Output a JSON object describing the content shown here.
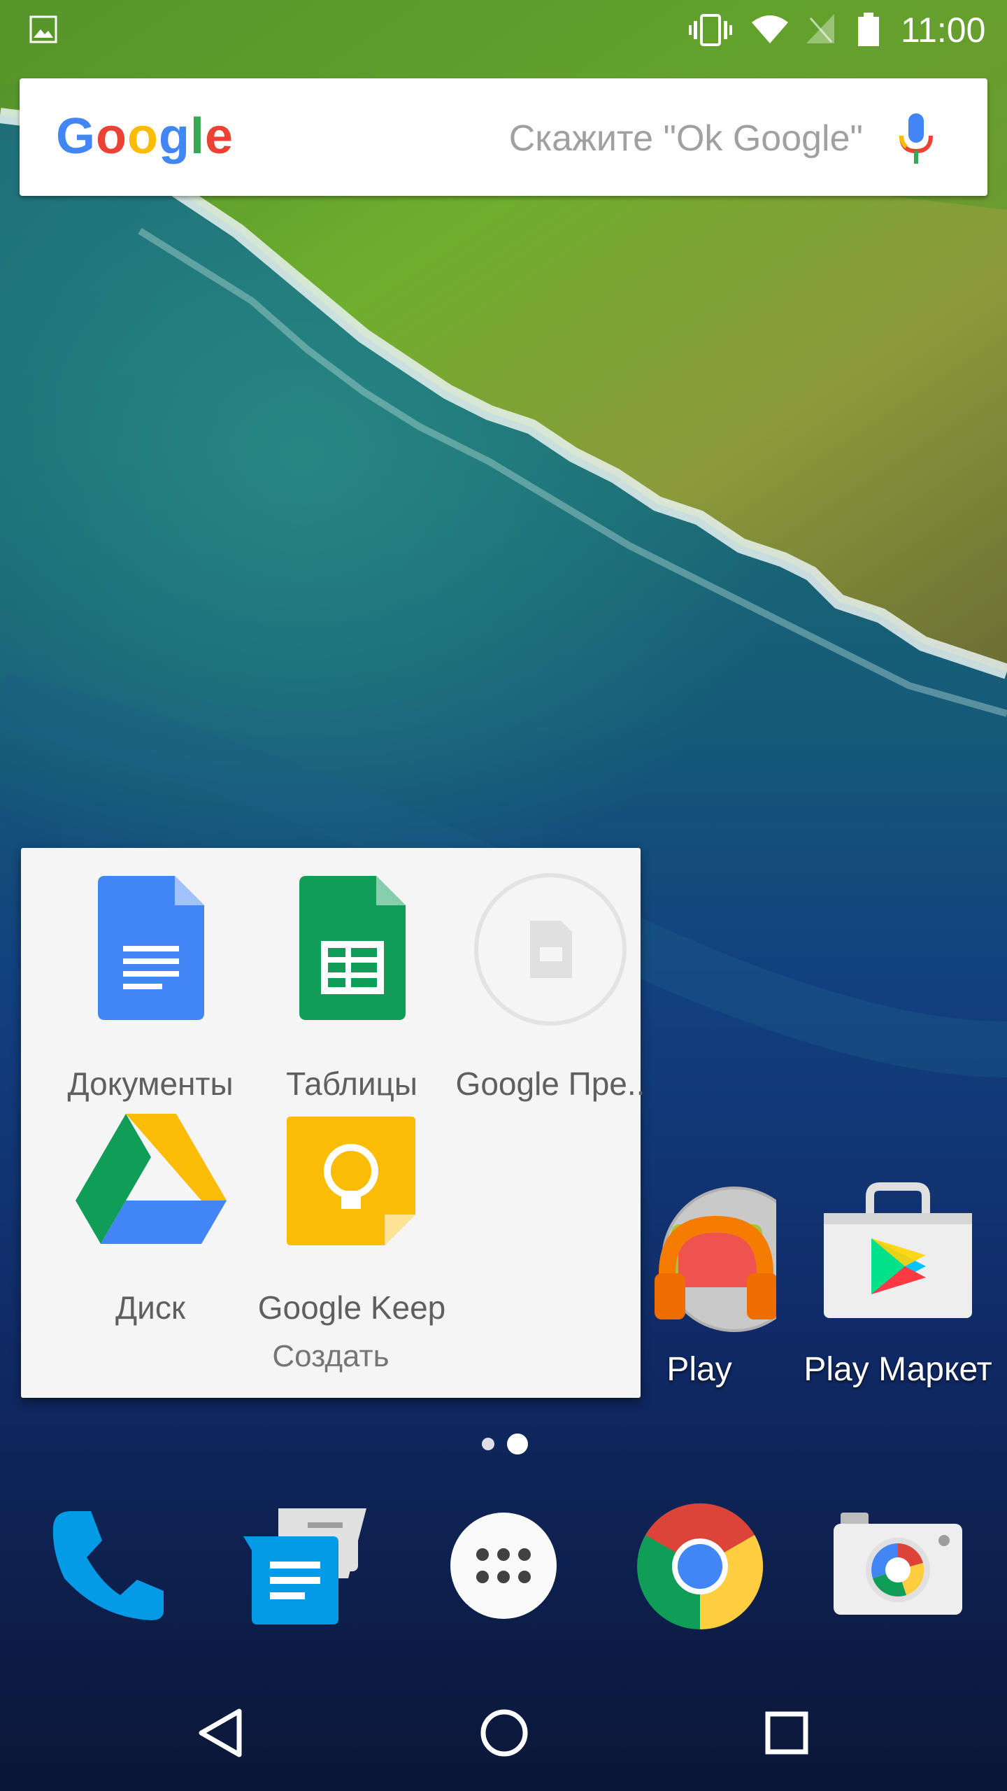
{
  "status_bar": {
    "time": "11:00",
    "icons": [
      "image-icon",
      "vibrate-icon",
      "wifi-icon",
      "no-signal-icon",
      "battery-icon"
    ]
  },
  "search": {
    "logo": [
      "G",
      "o",
      "o",
      "g",
      "l",
      "e"
    ],
    "hint": "Скажите \"Ok Google\"",
    "icon": "mic-icon"
  },
  "folder": {
    "name": "Создать",
    "apps": [
      {
        "label": "Документы",
        "icon": "docs-icon"
      },
      {
        "label": "Таблицы",
        "icon": "sheets-icon"
      },
      {
        "label": "Google Пре..",
        "icon": "slides-icon"
      },
      {
        "label": "Диск",
        "icon": "drive-icon"
      },
      {
        "label": "Google Keep",
        "icon": "keep-icon"
      }
    ]
  },
  "home_apps": [
    {
      "label": "Play",
      "icon": "play-music-folder-icon"
    },
    {
      "label": "Play Маркет",
      "icon": "play-store-icon"
    }
  ],
  "page_indicator": {
    "pages": 2,
    "current": 2
  },
  "dock": [
    "phone-icon",
    "messenger-icon",
    "app-drawer-icon",
    "chrome-icon",
    "camera-icon"
  ],
  "nav": [
    "back-icon",
    "home-icon",
    "recents-icon"
  ],
  "colors": {
    "google_blue": "#4285F4",
    "google_red": "#EA4335",
    "google_yellow": "#FBBC05",
    "google_green": "#34A853"
  }
}
